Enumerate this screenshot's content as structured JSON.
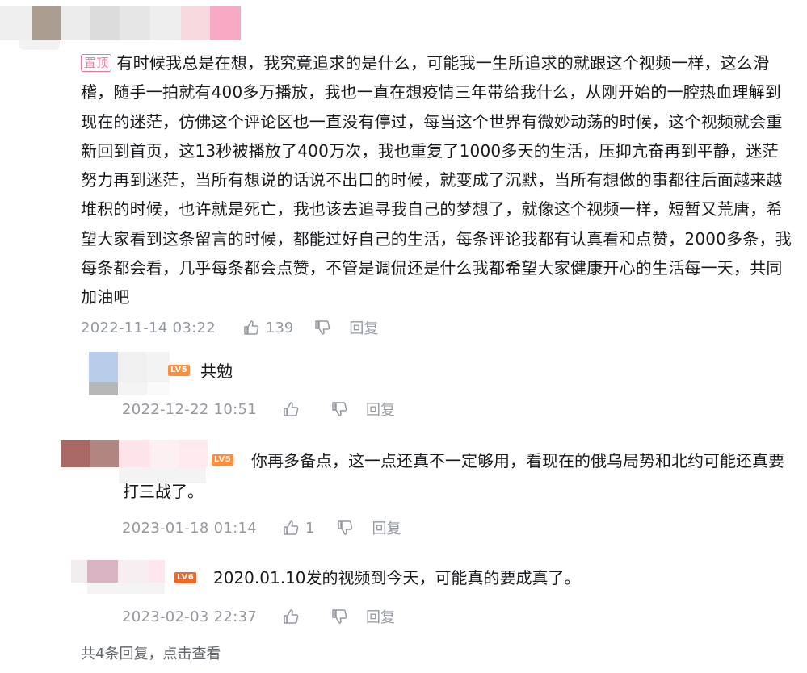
{
  "comment": {
    "pin_label": "置顶",
    "text": "有时候我总是在想，我究竟追求的是什么，可能我一生所追求的就跟这个视频一样，这么滑稽，随手一拍就有400多万播放，我也一直在想疫情三年带给我什么，从刚开始的一腔热血理解到现在的迷茫，仿佛这个评论区也一直没有停过，每当这个世界有微妙动荡的时候，这个视频就会重新回到首页，这13秒被播放了400万次，我也重复了1000多天的生活，压抑亢奋再到平静，迷茫努力再到迷茫，当所有想说的话说不出口的时候，就变成了沉默，当所有想做的事都往后面越来越堆积的时候，也许就是死亡，我也该去追寻我自己的梦想了，就像这个视频一样，短暂又荒唐，希望大家看到这条留言的时候，都能过好自己的生活，每条评论我都有认真看和点赞，2000多条，我每条都会看，几乎每条都会点赞，不管是调侃还是什么我都希望大家健康开心的生活每一天，共同加油吧",
    "date": "2022-11-14 03:22",
    "likes": "139",
    "reply_label": "回复"
  },
  "replies": [
    {
      "level": "LV5",
      "level_color": "#ff8d3b",
      "text": "共勉",
      "date": "2022-12-22 10:51",
      "likes": "",
      "reply_label": "回复"
    },
    {
      "level": "LV5",
      "level_color": "#ff8d3b",
      "text": "你再多备点，这一点还真不一定够用，看现在的俄乌局势和北约可能还真要打三战了。",
      "date": "2023-01-18 01:14",
      "likes": "1",
      "reply_label": "回复"
    },
    {
      "level": "LV6",
      "level_color": "#ee672a",
      "text": "2020.01.10发的视频到今天，可能真的要成真了。",
      "date": "2023-02-03 22:37",
      "likes": "",
      "reply_label": "回复"
    }
  ],
  "view_all": "共4条回复，点击查看",
  "icons": {
    "like": "thumbs-up-icon",
    "dislike": "thumbs-down-icon"
  },
  "colors": {
    "text": "#18191c",
    "meta": "#9499a0",
    "pin": "#fb7299"
  }
}
